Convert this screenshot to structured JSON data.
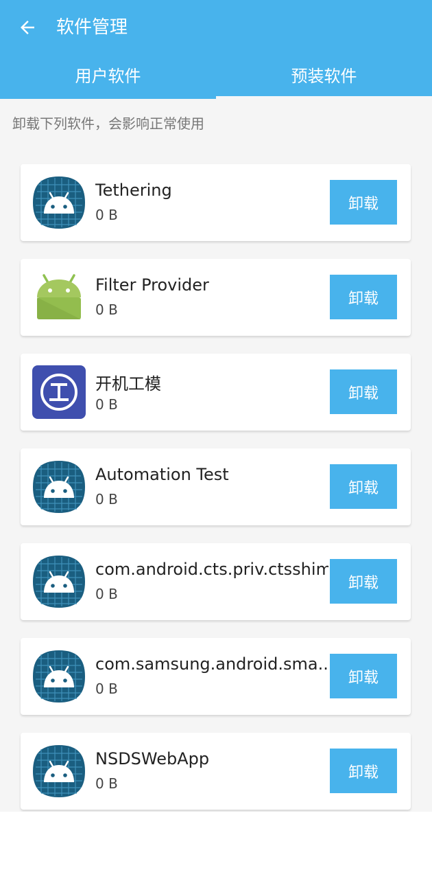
{
  "header": {
    "title": "软件管理",
    "back_icon": "arrow-left-icon"
  },
  "tabs": [
    {
      "label": "用户软件",
      "active": false
    },
    {
      "label": "预装软件",
      "active": true
    }
  ],
  "hint": "卸载下列软件，会影响正常使用",
  "colors": {
    "accent": "#48b3ec",
    "background": "#f5f5f5"
  },
  "apps": [
    {
      "name": "Tethering",
      "size": "0 B",
      "icon": "android-grid-icon",
      "button": "卸载"
    },
    {
      "name": "Filter Provider",
      "size": "0 B",
      "icon": "android-green-icon",
      "button": "卸载"
    },
    {
      "name": "开机工模",
      "size": "0 B",
      "icon": "circle-i-icon",
      "button": "卸载"
    },
    {
      "name": "Automation Test",
      "size": "0 B",
      "icon": "android-grid-icon",
      "button": "卸载"
    },
    {
      "name": "com.android.cts.priv.ctsshim",
      "size": "0 B",
      "icon": "android-grid-icon",
      "button": "卸载"
    },
    {
      "name": "com.samsung.android.sma..",
      "size": "0 B",
      "icon": "android-grid-icon",
      "button": "卸载"
    },
    {
      "name": "NSDSWebApp",
      "size": "0 B",
      "icon": "android-grid-icon",
      "button": "卸载"
    }
  ]
}
